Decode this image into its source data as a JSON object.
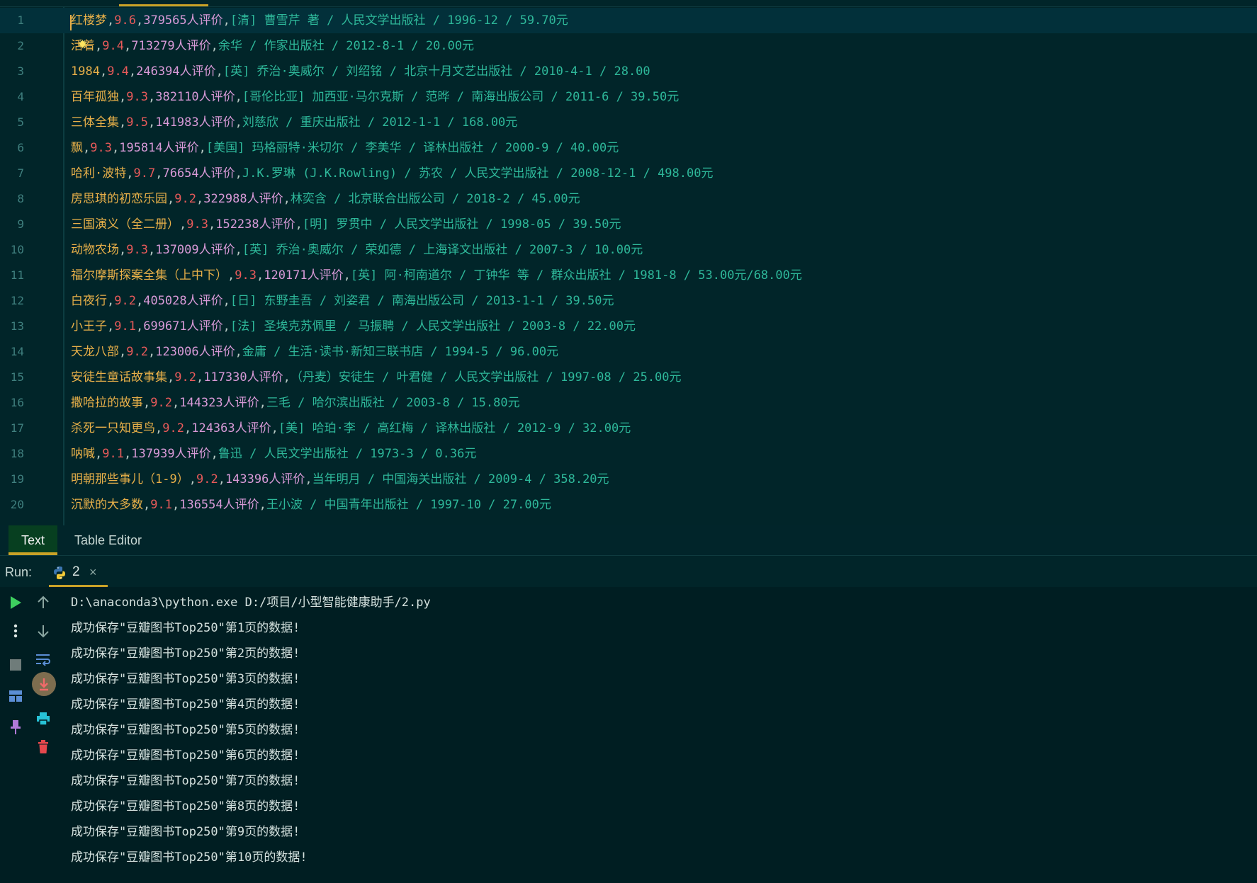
{
  "editor": {
    "lines": [
      {
        "n": "1",
        "title": "红楼梦",
        "rating": "9.6",
        "count": "379565",
        "count_suffix": "人评价",
        "rest": "[清] 曹雪芹 著 / 人民文学出版社 / 1996-12 / 59.70元"
      },
      {
        "n": "2",
        "title": "活着",
        "rating": "9.4",
        "count": "713279",
        "count_suffix": "人评价",
        "rest": "余华 / 作家出版社 / 2012-8-1 / 20.00元"
      },
      {
        "n": "3",
        "title": "1984",
        "rating": "9.4",
        "count": "246394",
        "count_suffix": "人评价",
        "rest": "[英] 乔治·奥威尔 / 刘绍铭 / 北京十月文艺出版社 / 2010-4-1 / 28.00"
      },
      {
        "n": "4",
        "title": "百年孤独",
        "rating": "9.3",
        "count": "382110",
        "count_suffix": "人评价",
        "rest": "[哥伦比亚] 加西亚·马尔克斯 / 范晔 / 南海出版公司 / 2011-6 / 39.50元"
      },
      {
        "n": "5",
        "title": "三体全集",
        "rating": "9.5",
        "count": "141983",
        "count_suffix": "人评价",
        "rest": "刘慈欣 / 重庆出版社 / 2012-1-1 / 168.00元"
      },
      {
        "n": "6",
        "title": "飘",
        "rating": "9.3",
        "count": "195814",
        "count_suffix": "人评价",
        "rest": "[美国] 玛格丽特·米切尔 / 李美华 / 译林出版社 / 2000-9 / 40.00元"
      },
      {
        "n": "7",
        "title": "哈利·波特",
        "rating": "9.7",
        "count": "76654",
        "count_suffix": "人评价",
        "rest": "J.K.罗琳 (J.K.Rowling) / 苏农 / 人民文学出版社 / 2008-12-1 / 498.00元"
      },
      {
        "n": "8",
        "title": "房思琪的初恋乐园",
        "rating": "9.2",
        "count": "322988",
        "count_suffix": "人评价",
        "rest": "林奕含 / 北京联合出版公司 / 2018-2 / 45.00元"
      },
      {
        "n": "9",
        "title": "三国演义（全二册）",
        "rating": "9.3",
        "count": "152238",
        "count_suffix": "人评价",
        "rest": "[明] 罗贯中 / 人民文学出版社 / 1998-05 / 39.50元"
      },
      {
        "n": "10",
        "title": "动物农场",
        "rating": "9.3",
        "count": "137009",
        "count_suffix": "人评价",
        "rest": "[英] 乔治·奥威尔 / 荣如德 / 上海译文出版社 / 2007-3 / 10.00元"
      },
      {
        "n": "11",
        "title": "福尔摩斯探案全集（上中下）",
        "rating": "9.3",
        "count": "120171",
        "count_suffix": "人评价",
        "rest": "[英] 阿·柯南道尔 / 丁钟华 等 / 群众出版社 / 1981-8 / 53.00元/68.00元"
      },
      {
        "n": "12",
        "title": "白夜行",
        "rating": "9.2",
        "count": "405028",
        "count_suffix": "人评价",
        "rest": "[日] 东野圭吾 / 刘姿君 / 南海出版公司 / 2013-1-1 / 39.50元"
      },
      {
        "n": "13",
        "title": "小王子",
        "rating": "9.1",
        "count": "699671",
        "count_suffix": "人评价",
        "rest": "[法] 圣埃克苏佩里 / 马振聘 / 人民文学出版社 / 2003-8 / 22.00元"
      },
      {
        "n": "14",
        "title": "天龙八部",
        "rating": "9.2",
        "count": "123006",
        "count_suffix": "人评价",
        "rest": "金庸 / 生活·读书·新知三联书店 / 1994-5 / 96.00元"
      },
      {
        "n": "15",
        "title": "安徒生童话故事集",
        "rating": "9.2",
        "count": "117330",
        "count_suffix": "人评价",
        "rest": "（丹麦）安徒生 / 叶君健 / 人民文学出版社 / 1997-08 / 25.00元"
      },
      {
        "n": "16",
        "title": "撒哈拉的故事",
        "rating": "9.2",
        "count": "144323",
        "count_suffix": "人评价",
        "rest": "三毛 / 哈尔滨出版社 / 2003-8 / 15.80元"
      },
      {
        "n": "17",
        "title": "杀死一只知更鸟",
        "rating": "9.2",
        "count": "124363",
        "count_suffix": "人评价",
        "rest": "[美] 哈珀·李 / 高红梅 / 译林出版社 / 2012-9 / 32.00元"
      },
      {
        "n": "18",
        "title": "呐喊",
        "rating": "9.1",
        "count": "137939",
        "count_suffix": "人评价",
        "rest": "鲁迅 / 人民文学出版社 / 1973-3 / 0.36元"
      },
      {
        "n": "19",
        "title": "明朝那些事儿（1-9）",
        "rating": "9.2",
        "count": "143396",
        "count_suffix": "人评价",
        "rest": "当年明月 / 中国海关出版社 / 2009-4 / 358.20元"
      },
      {
        "n": "20",
        "title": "沉默的大多数",
        "rating": "9.1",
        "count": "136554",
        "count_suffix": "人评价",
        "rest": "王小波 / 中国青年出版社 / 1997-10 / 27.00元"
      }
    ]
  },
  "tabs": {
    "text": "Text",
    "table_editor": "Table Editor"
  },
  "run": {
    "label": "Run:",
    "tab_name": "2",
    "tab_close": "×"
  },
  "console": {
    "lines": [
      "D:\\anaconda3\\python.exe D:/项目/小型智能健康助手/2.py",
      "成功保存\"豆瓣图书Top250\"第1页的数据!",
      "成功保存\"豆瓣图书Top250\"第2页的数据!",
      "成功保存\"豆瓣图书Top250\"第3页的数据!",
      "成功保存\"豆瓣图书Top250\"第4页的数据!",
      "成功保存\"豆瓣图书Top250\"第5页的数据!",
      "成功保存\"豆瓣图书Top250\"第6页的数据!",
      "成功保存\"豆瓣图书Top250\"第7页的数据!",
      "成功保存\"豆瓣图书Top250\"第8页的数据!",
      "成功保存\"豆瓣图书Top250\"第9页的数据!",
      "成功保存\"豆瓣图书Top250\"第10页的数据!"
    ]
  },
  "toolbar": {
    "left": [
      "play-icon",
      "more-vertical-icon",
      "stop-icon",
      "layout-icon",
      "pin-icon"
    ],
    "right": [
      "arrow-up-icon",
      "arrow-down-icon",
      "soft-wrap-icon",
      "scroll-to-end-icon",
      "print-icon",
      "trash-icon"
    ]
  },
  "colors": {
    "background": "#012529",
    "title": "#e8b049",
    "rating": "#e85a5a",
    "count": "#d89ad8",
    "rest": "#2eb89a",
    "accent": "#c9a227",
    "run_green": "#3ecf5f",
    "trash_red": "#e5484d"
  }
}
